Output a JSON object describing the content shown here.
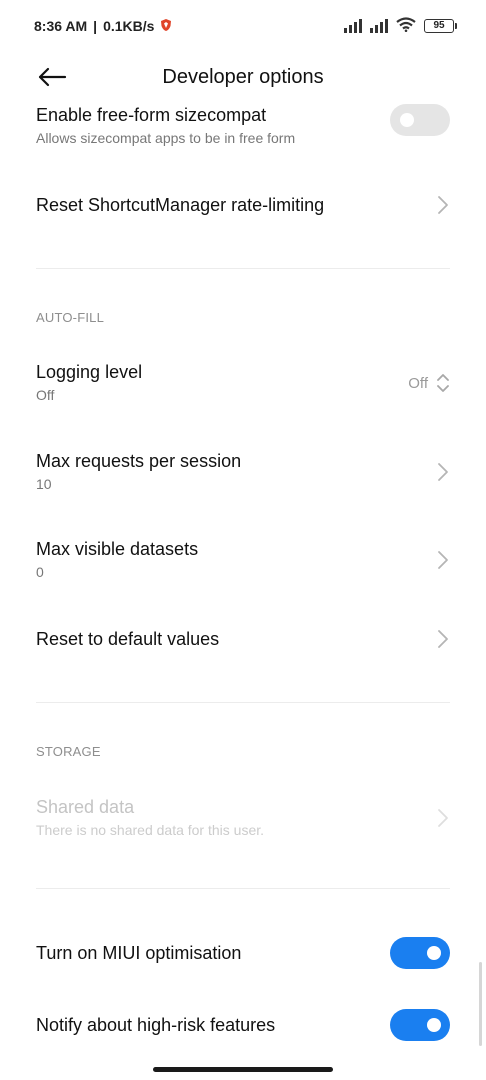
{
  "status_bar": {
    "time": "8:36 AM",
    "speed": "0.1KB/s",
    "battery": "95"
  },
  "app_bar": {
    "title": "Developer options"
  },
  "items": {
    "freeform": {
      "title": "Enable free-form sizecompat",
      "summary": "Allows sizecompat apps to be in free form",
      "enabled": false
    },
    "reset_shortcut": {
      "title": "Reset ShortcutManager rate-limiting"
    },
    "logging_level": {
      "title": "Logging level",
      "summary": "Off",
      "value": "Off"
    },
    "max_requests": {
      "title": "Max requests per session",
      "summary": "10"
    },
    "max_datasets": {
      "title": "Max visible datasets",
      "summary": "0"
    },
    "reset_defaults": {
      "title": "Reset to default values"
    },
    "shared_data": {
      "title": "Shared data",
      "summary": "There is no shared data for this user."
    },
    "miui_optimisation": {
      "title": "Turn on MIUI optimisation",
      "enabled": true
    },
    "high_risk": {
      "title": "Notify about high-risk features",
      "enabled": true
    }
  },
  "sections": {
    "autofill": "AUTO-FILL",
    "storage": "STORAGE"
  },
  "colors": {
    "accent": "#1a7ff0",
    "toggle_off": "#e5e5e5",
    "disabled_text": "#c4c4c4"
  }
}
